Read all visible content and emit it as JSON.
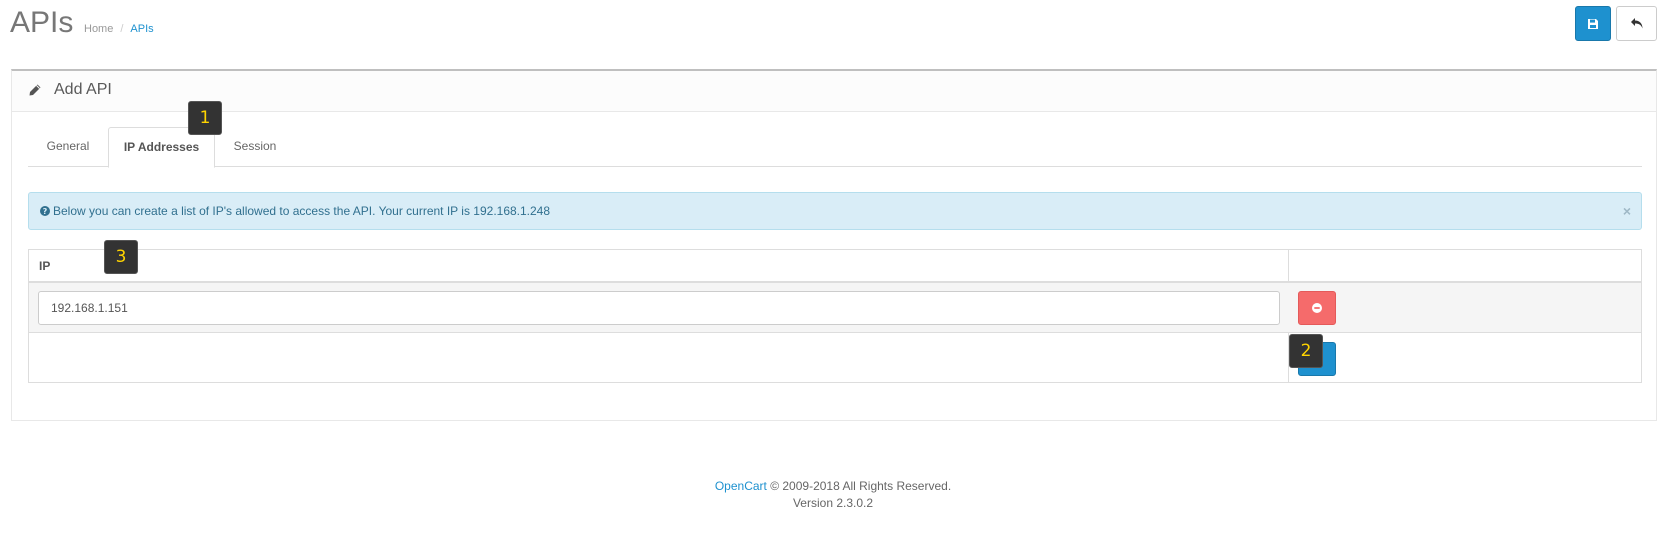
{
  "header": {
    "title": "APIs",
    "breadcrumb": [
      {
        "label": "Home"
      },
      {
        "label": "APIs"
      }
    ],
    "save_icon": "floppy-disk-icon",
    "back_icon": "reply-arrow-icon"
  },
  "panel": {
    "title": "Add API",
    "title_icon": "pencil-icon"
  },
  "tabs": [
    {
      "label": "General"
    },
    {
      "label": "IP Addresses",
      "active": true
    },
    {
      "label": "Session"
    }
  ],
  "alert": {
    "text": "Below you can create a list of IP's allowed to access the API. Your current IP is 192.168.1.248",
    "close": "×"
  },
  "table": {
    "header_ip": "IP",
    "rows": [
      {
        "ip": "192.168.1.151"
      }
    ]
  },
  "markers": [
    "1",
    "2",
    "3"
  ],
  "footer": {
    "brand": "OpenCart",
    "copyright": " © 2009-2018 All Rights Reserved.",
    "version": "Version 2.3.0.2"
  },
  "colors": {
    "primary": "#1e91cf",
    "danger": "#f56b6b",
    "info_bg": "#d9edf7",
    "marker_bg": "#333333",
    "marker_text": "#ffd400"
  }
}
